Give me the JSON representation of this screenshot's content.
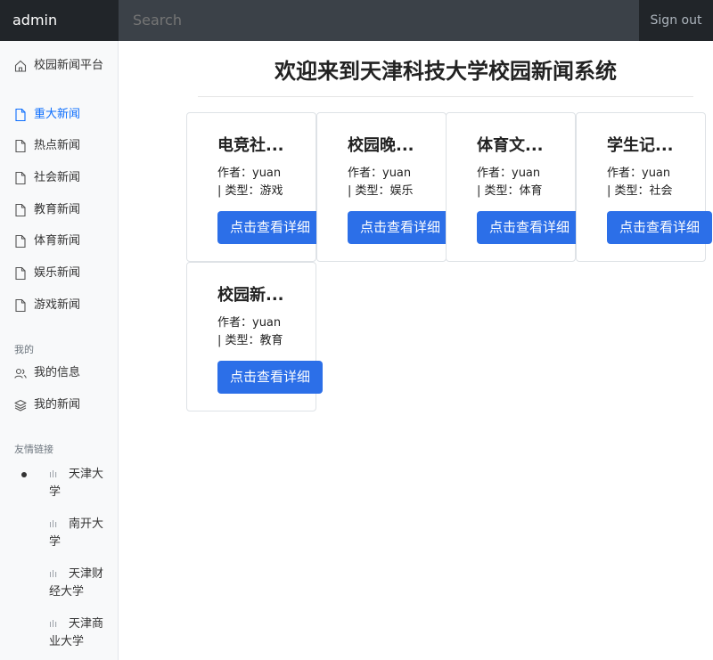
{
  "header": {
    "brand": "admin",
    "search_placeholder": "Search",
    "signout_label": "Sign out"
  },
  "sidebar": {
    "home": "校园新闻平台",
    "news_items": [
      "重大新闻",
      "热点新闻",
      "社会新闻",
      "教育新闻",
      "体育新闻",
      "娱乐新闻",
      "游戏新闻"
    ],
    "active_index": 0,
    "section_mine": "我的",
    "mine_items": [
      "我的信息",
      "我的新闻"
    ],
    "section_links": "友情链接",
    "links": [
      "天津大学",
      "南开大学",
      "天津财经大学",
      "天津商业大学"
    ],
    "accent_color": "#0d6efd"
  },
  "main": {
    "title": "欢迎来到天津科技大学校园新闻系统",
    "cards": [
      {
        "title": "电竞社...",
        "author": "作者：yuan",
        "type": "| 类型：游戏",
        "button": "点击查看详细"
      },
      {
        "title": "校园晚...",
        "author": "作者：yuan",
        "type": "| 类型：娱乐",
        "button": "点击查看详细"
      },
      {
        "title": "体育文...",
        "author": "作者：yuan",
        "type": "| 类型：体育",
        "button": "点击查看详细"
      },
      {
        "title": "学生记...",
        "author": "作者：yuan",
        "type": "| 类型：社会",
        "button": "点击查看详细"
      },
      {
        "title": "校园新...",
        "author": "作者：yuan",
        "type": "| 类型：教育",
        "button": "点击查看详细"
      }
    ],
    "button_color": "#2c6fe8"
  }
}
